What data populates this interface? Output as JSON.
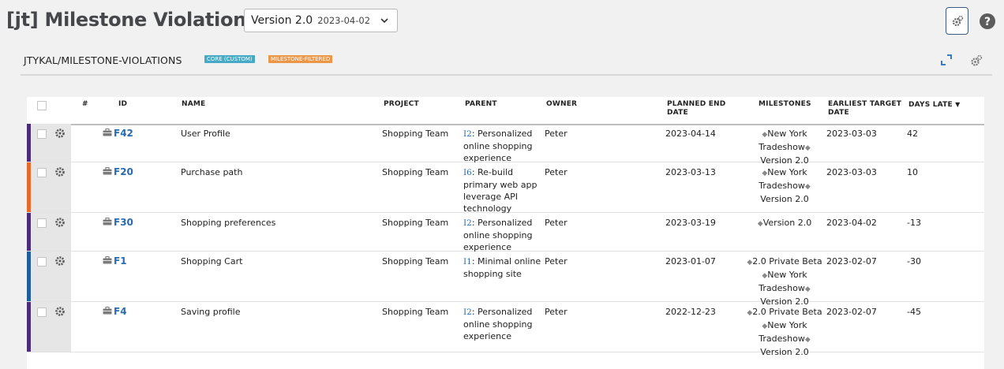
{
  "header": {
    "title": "[jt] Milestone Violations",
    "version_select": {
      "label": "Version 2.0",
      "date": "2023-04-02"
    }
  },
  "gadget": {
    "title": "JTYKAL/MILESTONE-VIOLATIONS",
    "badges": {
      "core": "CORE (CUSTOM)",
      "milestone": "MILESTONE-FILTERED"
    }
  },
  "table": {
    "columns": {
      "hash": "#",
      "id": "ID",
      "name": "NAME",
      "project": "PROJECT",
      "parent": "PARENT",
      "owner": "OWNER",
      "planned_end_1": "PLANNED END",
      "planned_end_2": "DATE",
      "milestones": "MILESTONES",
      "earliest_1": "EARLIEST TARGET",
      "earliest_2": "DATE",
      "days_late": "DAYS LATE",
      "sort_indicator": "▼"
    },
    "rows": [
      {
        "stripe_color": "#4a2c7a",
        "id": "F42",
        "name": "User Profile",
        "project": "Shopping Team",
        "parent_key": "I2",
        "parent_text": ": Personalized online shopping experience",
        "owner": "Peter",
        "planned_end": "2023-04-14",
        "ms_lines": [
          "◆New York",
          "Tradeshow◆",
          "Version 2.0"
        ],
        "earliest": "2023-03-03",
        "days_late": "42"
      },
      {
        "stripe_color": "#e8692b",
        "id": "F20",
        "name": "Purchase path",
        "project": "Shopping Team",
        "parent_key": "I6",
        "parent_text": ": Re-build primary web app leverage API technology",
        "owner": "Peter",
        "planned_end": "2023-03-13",
        "ms_lines": [
          "◆New York",
          "Tradeshow◆",
          "Version 2.0"
        ],
        "earliest": "2023-03-03",
        "days_late": "10"
      },
      {
        "stripe_color": "#4a2c7a",
        "id": "F30",
        "name": "Shopping preferences",
        "project": "Shopping Team",
        "parent_key": "I2",
        "parent_text": ": Personalized online shopping experience",
        "owner": "Peter",
        "planned_end": "2023-03-19",
        "ms_lines": [
          "◆Version 2.0"
        ],
        "earliest": "2023-04-02",
        "days_late": "-13"
      },
      {
        "stripe_color": "#1f5e9b",
        "id": "F1",
        "name": "Shopping Cart",
        "project": "Shopping Team",
        "parent_key": "I1",
        "parent_text": ": Minimal online shopping site",
        "owner": "Peter",
        "planned_end": "2023-01-07",
        "ms_lines": [
          "◆2.0 Private Beta",
          "◆New York",
          "Tradeshow◆",
          "Version 2.0"
        ],
        "earliest": "2023-02-07",
        "days_late": "-30"
      },
      {
        "stripe_color": "#4a2c7a",
        "id": "F4",
        "name": "Saving profile",
        "project": "Shopping Team",
        "parent_key": "I2",
        "parent_text": ": Personalized online shopping experience",
        "owner": "Peter",
        "planned_end": "2022-12-23",
        "ms_lines": [
          "◆2.0 Private Beta",
          "◆New York",
          "Tradeshow◆",
          "Version 2.0"
        ],
        "earliest": "2023-02-07",
        "days_late": "-45"
      }
    ]
  }
}
